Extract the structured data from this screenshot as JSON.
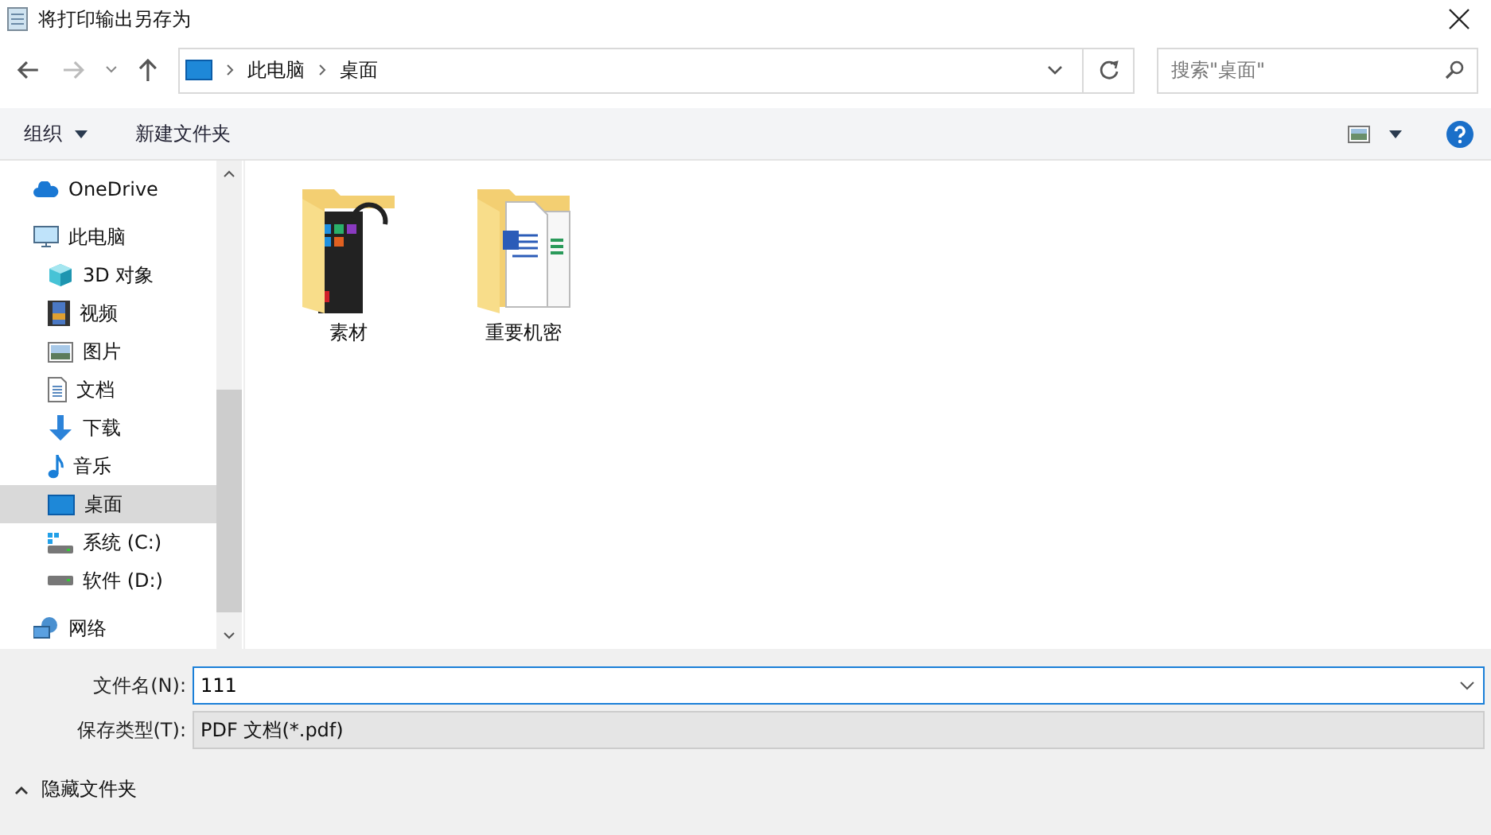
{
  "window": {
    "title": "将打印输出另存为"
  },
  "address": {
    "path": [
      "此电脑",
      "桌面"
    ]
  },
  "search": {
    "placeholder": "搜索\"桌面\""
  },
  "toolbar": {
    "organize": "组织",
    "new_folder": "新建文件夹"
  },
  "sidebar": {
    "items": [
      {
        "label": "OneDrive",
        "kind": "cloud",
        "selected": false
      },
      {
        "label": "此电脑",
        "kind": "pc",
        "selected": false,
        "children": [
          {
            "label": "3D 对象",
            "kind": "cube",
            "selected": false
          },
          {
            "label": "视频",
            "kind": "film",
            "selected": false
          },
          {
            "label": "图片",
            "kind": "image",
            "selected": false
          },
          {
            "label": "文档",
            "kind": "doc",
            "selected": false
          },
          {
            "label": "下载",
            "kind": "download",
            "selected": false
          },
          {
            "label": "音乐",
            "kind": "music",
            "selected": false
          },
          {
            "label": "桌面",
            "kind": "desktop",
            "selected": true
          },
          {
            "label": "系统 (C:)",
            "kind": "sysdrive",
            "selected": false
          },
          {
            "label": "软件 (D:)",
            "kind": "drive",
            "selected": false
          }
        ]
      },
      {
        "label": "网络",
        "kind": "network",
        "selected": false
      }
    ]
  },
  "files": [
    {
      "name": "素材",
      "kind": "media"
    },
    {
      "name": "重要机密",
      "kind": "docs"
    }
  ],
  "form": {
    "filename_label": "文件名(N):",
    "filename": "111",
    "type_label": "保存类型(T):",
    "type": "PDF 文档(*.pdf)"
  },
  "footer": {
    "hide_folders": "隐藏文件夹"
  }
}
